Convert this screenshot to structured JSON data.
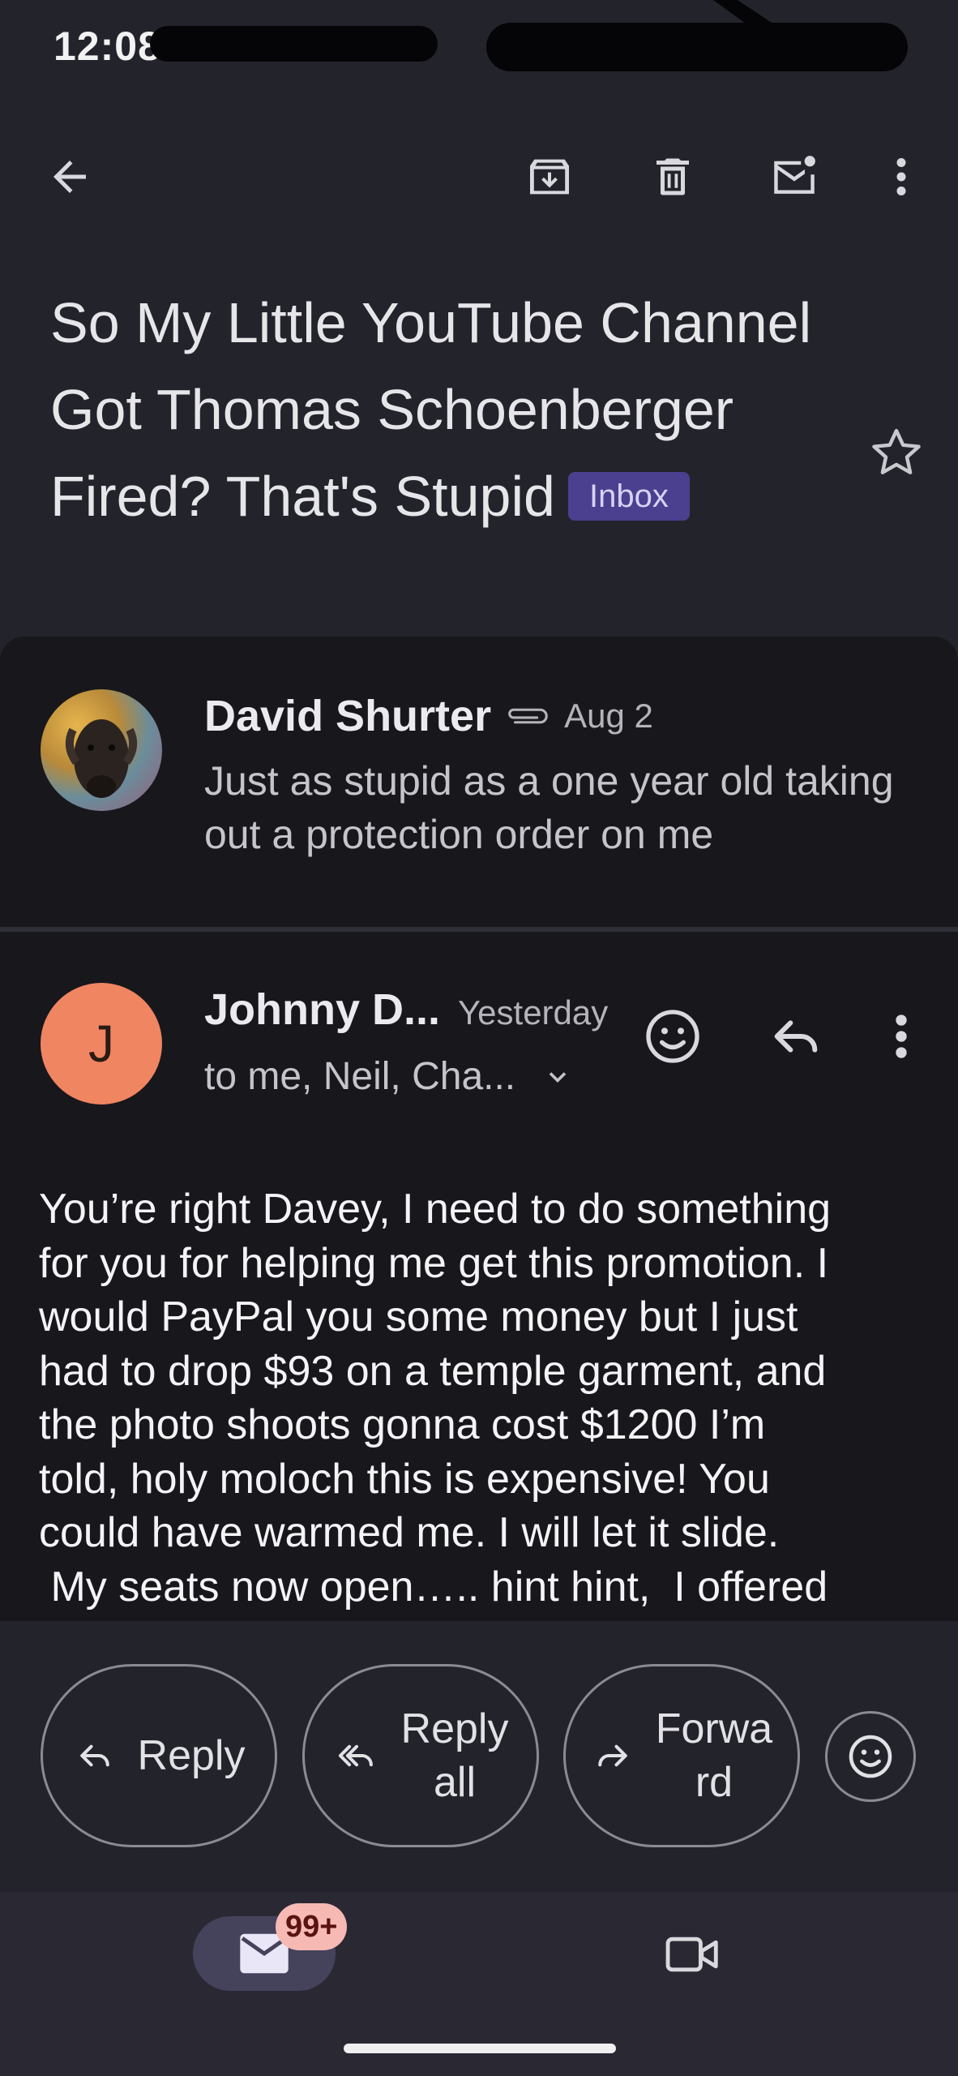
{
  "status_bar": {
    "time": "12:08"
  },
  "toolbar": {
    "back_icon": "arrow-left-icon",
    "archive_icon": "archive-icon",
    "delete_icon": "trash-icon",
    "mark_unread_icon": "mark-unread-icon",
    "more_icon": "more-vertical-icon"
  },
  "subject": {
    "text": "So My Little YouTube Channel Got Thomas Schoenberger Fired? That's Stupid",
    "label": "Inbox"
  },
  "messages": [
    {
      "sender": "David Shurter",
      "date": "Aug 2",
      "has_attachment": true,
      "snippet": "Just as stupid as a one year old taking out a protection order on me"
    },
    {
      "sender": "Johnny D...",
      "date": "Yesterday",
      "avatar_letter": "J",
      "recipients": "to me, Neil, Cha...",
      "body_lines": [
        "You’re right Davey,  I need to do something",
        "for you for helping me get this promotion. I",
        "would PayPal you some money but I just",
        "had to drop $93 on a temple garment, and",
        "the photo shoots gonna cost $1200 I’m",
        "told,  holy moloch this is expensive! You",
        "could have warmed me. I will let it slide.",
        " My seats now open….. hint hint,  I offered"
      ]
    }
  ],
  "actions": {
    "reply": "Reply",
    "reply_all_1": "Reply",
    "reply_all_2": "all",
    "forward_1": "Forwa",
    "forward_2": "rd"
  },
  "bottom_nav": {
    "mail_badge": "99+"
  },
  "colors": {
    "background": "#23232b",
    "card": "#18171c",
    "accent_label": "#4b3f8f",
    "avatar_j": "#f08562"
  }
}
